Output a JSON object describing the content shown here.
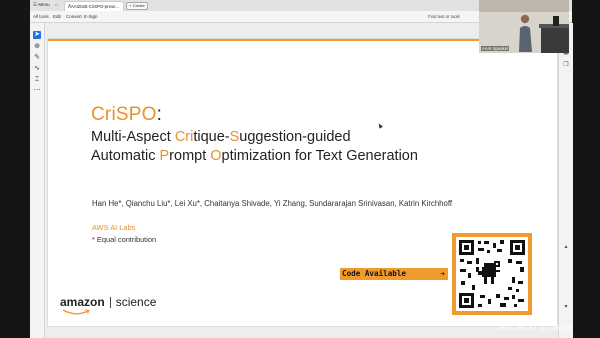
{
  "app": {
    "tabbar": {
      "menu_label": "Menu",
      "tab_title": "AAAI2025-CriSPO-prese...",
      "new_tab_label": "+ Create"
    },
    "menubar": {
      "items": [
        "All tools",
        "Edit",
        "Convert",
        "E-Sign"
      ],
      "find_label": "Find text or tools"
    },
    "left_tools": [
      "cursor-tool",
      "zoom-tool",
      "comment-tool",
      "draw-tool",
      "text-tool",
      "more-tool"
    ],
    "right_tools": [
      "panel-tool-1",
      "panel-tool-2"
    ]
  },
  "slide": {
    "title": "CriSPO",
    "title_colon": ":",
    "subtitle_line1": [
      "Multi-Aspect ",
      "Cri",
      "tique-",
      "S",
      "uggestion-guided"
    ],
    "subtitle_line2": [
      "Automatic ",
      "P",
      "rompt ",
      "O",
      "ptimization for Text Generation"
    ],
    "authors": "Han He*, Qianchu Liu*, Lei Xu*, Chaitanya Shivade, Yi Zhang, Sundararajan Srinivasan, Katrin Kirchhoff",
    "affiliation": "AWS AI Labs",
    "equal_contribution": "* Equal contribution",
    "code_available": "Code Available",
    "code_arrow": "➔",
    "logo_amazon": "amazon",
    "logo_science": "science",
    "accent_color": "#f29b2d"
  },
  "webcam": {
    "label": "AAAI Speaker"
  },
  "timestamp": "2025-02-27 22:39:28"
}
